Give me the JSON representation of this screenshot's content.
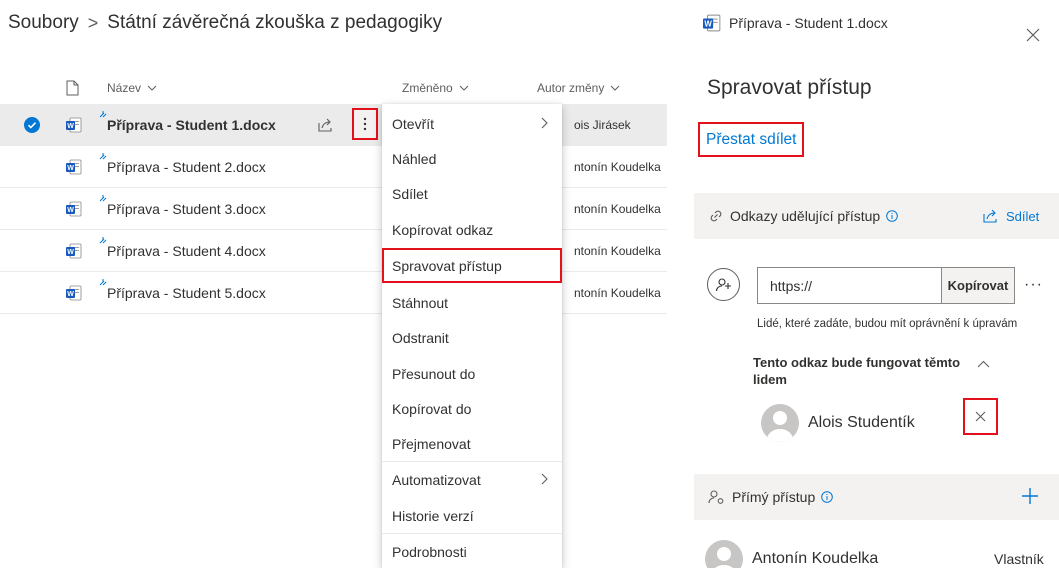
{
  "breadcrumb": {
    "root": "Soubory",
    "current": "Státní závěrečná zkouška z pedagogiky"
  },
  "list": {
    "columns": {
      "name": "Název",
      "modified": "Změněno",
      "modified_by": "Autor změny"
    },
    "rows": [
      {
        "name": "Příprava - Student 1.docx",
        "author": "ois Jirásek",
        "selected": true
      },
      {
        "name": "Příprava - Student 2.docx",
        "author": "ntonín Koudelka",
        "selected": false
      },
      {
        "name": "Příprava - Student 3.docx",
        "author": "ntonín Koudelka",
        "selected": false
      },
      {
        "name": "Příprava - Student 4.docx",
        "author": "ntonín Koudelka",
        "selected": false
      },
      {
        "name": "Příprava - Student 5.docx",
        "author": "ntonín Koudelka",
        "selected": false
      }
    ]
  },
  "context_menu": {
    "items": [
      {
        "label": "Otevřít",
        "submenu": true
      },
      {
        "label": "Náhled"
      },
      {
        "label": "Sdílet"
      },
      {
        "label": "Kopírovat odkaz"
      },
      {
        "label": "Spravovat přístup",
        "highlighted": true
      },
      {
        "label": "Stáhnout"
      },
      {
        "label": "Odstranit"
      },
      {
        "label": "Přesunout do"
      },
      {
        "label": "Kopírovat do"
      },
      {
        "label": "Přejmenovat"
      },
      {
        "label": "Automatizovat",
        "submenu": true
      },
      {
        "label": "Historie verzí"
      },
      {
        "label": "Podrobnosti"
      }
    ]
  },
  "panel": {
    "file_title": "Příprava - Student 1.docx",
    "heading": "Spravovat přístup",
    "stop_sharing": "Přestat sdílet",
    "links_section": {
      "title": "Odkazy udělující přístup",
      "share_label": "Sdílet",
      "link_value": "https://",
      "copy_label": "Kopírovat",
      "more_label": "···",
      "permission_text": "Lidé, které zadáte, budou mít oprávnění k úpravám",
      "audience_title": "Tento odkaz bude fungovat těmto lidem",
      "person_name": "Alois Studentík"
    },
    "direct_section": {
      "title": "Přímý přístup",
      "owner_name": "Antonín Koudelka",
      "owner_role": "Vlastník"
    }
  },
  "colors": {
    "accent": "#0078d4",
    "highlight_border": "#e3111b",
    "word_blue": "#185abd",
    "selection_bg": "#ebebeb"
  },
  "icons": [
    "document-icon",
    "word-file-icon",
    "check-circle-icon",
    "share-icon",
    "more-vertical-icon",
    "chevron-right-icon",
    "close-icon",
    "link-icon",
    "info-icon",
    "add-people-icon",
    "chevron-up-icon",
    "person-avatar-icon",
    "plus-icon",
    "people-settings-icon"
  ]
}
